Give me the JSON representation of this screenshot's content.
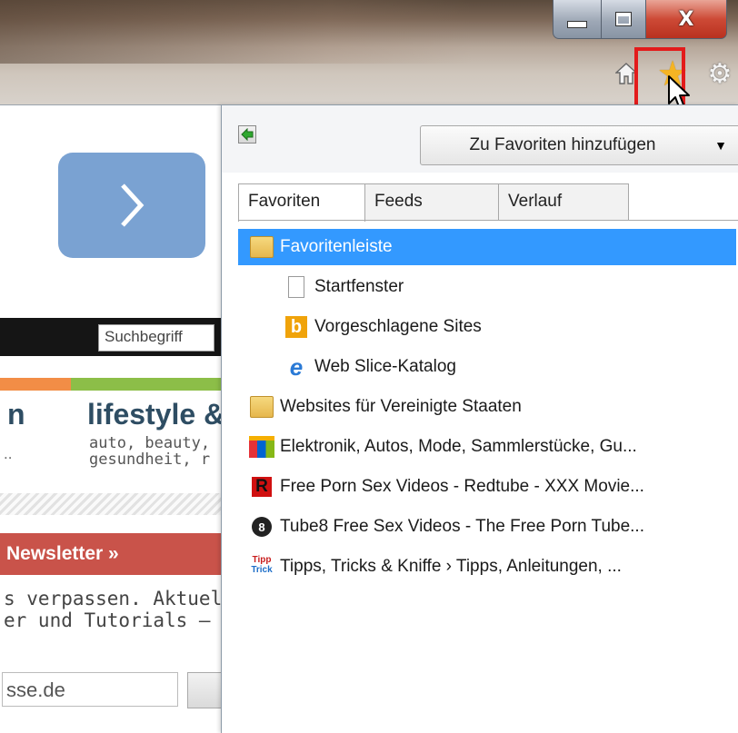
{
  "window": {
    "close_glyph": "X"
  },
  "page": {
    "search_placeholder": "Suchbegriff",
    "heading_partial": "lifestyle &",
    "heading_prefix": "n",
    "sub_line1": "auto, beauty,",
    "sub_line2": "gesundheit, r",
    "dots": "..",
    "newsletter_label": "Newsletter »",
    "newsletter_text1": "s verpassen. Aktuell",
    "newsletter_text2": "er und Tutorials – p",
    "email_value": "sse.de"
  },
  "flyout": {
    "add_favorites_label": "Zu Favoriten hinzufügen",
    "tabs": [
      {
        "label": "Favoriten"
      },
      {
        "label": "Feeds"
      },
      {
        "label": "Verlauf"
      }
    ],
    "items": [
      {
        "label": "Favoritenleiste",
        "icon": "folder-icon"
      },
      {
        "label": "Startfenster",
        "icon": "page-icon"
      },
      {
        "label": "Vorgeschlagene Sites",
        "icon": "bing-icon"
      },
      {
        "label": "Web Slice-Katalog",
        "icon": "ie-icon"
      },
      {
        "label": "Websites für Vereinigte Staaten",
        "icon": "folder-icon"
      },
      {
        "label": "Elektronik, Autos, Mode, Sammlerstücke, Gu...",
        "icon": "ebay-icon"
      },
      {
        "label": "Free Porn Sex Videos - Redtube - XXX Movie...",
        "icon": "redtube-icon"
      },
      {
        "label": "Tube8  Free Sex Videos - The Free Porn Tube...",
        "icon": "tube8-icon"
      },
      {
        "label": "Tipps, Tricks & Kniffe › Tipps, Anleitungen, ...",
        "icon": "tipps-icon"
      }
    ]
  },
  "icon_glyphs": {
    "bing": "b",
    "ie": "e",
    "redtube": "R",
    "tube8": "8",
    "tipps_top": "Tipp",
    "tipps_bottom": "Trick"
  },
  "colors": {
    "selection": "#3399ff",
    "highlight_box": "#e31b1b",
    "star": "#f5b423"
  }
}
